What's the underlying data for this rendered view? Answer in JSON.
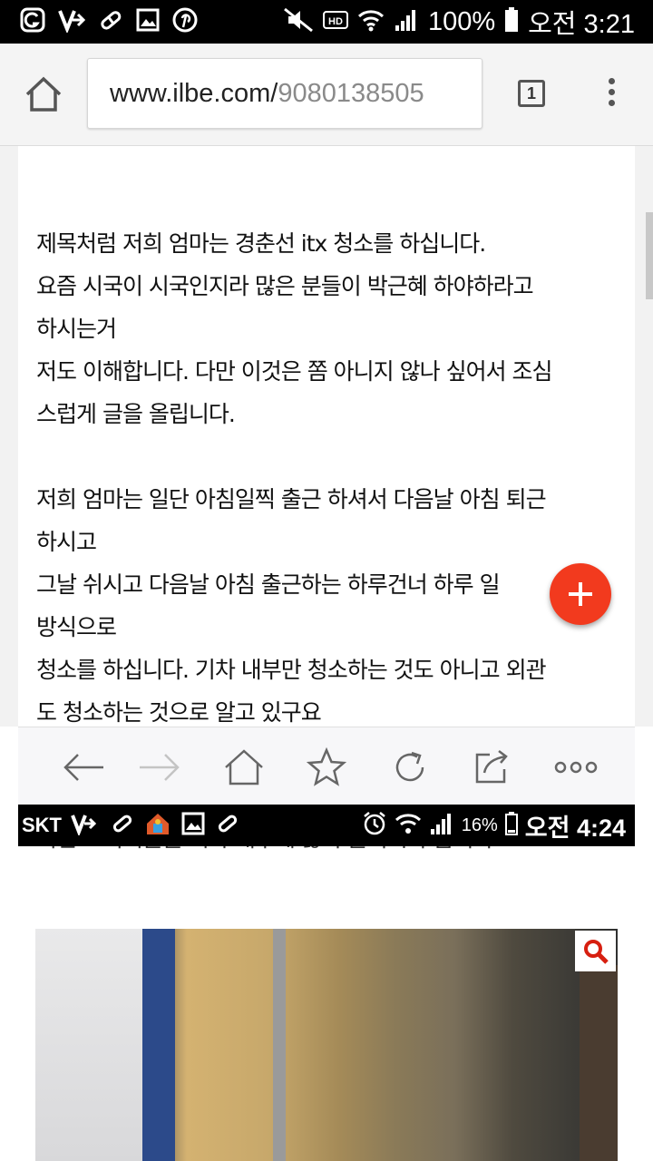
{
  "status_bar": {
    "battery": "100%",
    "time": "오전 3:21",
    "icons": [
      "g-icon",
      "v-icon",
      "pill-icon",
      "image-icon",
      "pinterest-icon",
      "mute-icon",
      "hd-icon",
      "wifi-icon",
      "signal-icon",
      "battery-icon"
    ]
  },
  "url_bar": {
    "host": "www.ilbe.com/",
    "path": "9080138505",
    "tab_count": "1"
  },
  "article": {
    "lines": [
      "제목처럼 저희 엄마는 경춘선 itx 청소를 하십니다.",
      "요즘 시국이 시국인지라 많은 분들이 박근혜 하야하라고",
      "하시는거",
      "저도 이해합니다.  다만 이것은 쫌 아니지 않나 싶어서 조심",
      "스럽게 글을 올립니다.",
      "",
      "저희 엄마는 일단 아침일찍 출근 하셔서 다음날 아침 퇴근",
      "하시고",
      "그날 쉬시고 다음날 아침 출근하는 하루건너 하루 일",
      "방식으로",
      "청소를 하십니다. 기차 내부만 청소하는 것도 아니고 외관",
      "도 청소하는 것으로 알고 있구요"
    ],
    "partial_line": "이번 스티커들을 기차 내부에 많이 붙이시다 봅니다."
  },
  "bottom_bar": {
    "icons": [
      "back-arrow-icon",
      "forward-arrow-icon",
      "home-icon",
      "star-icon",
      "refresh-icon",
      "share-icon",
      "more-icon"
    ]
  },
  "screenshot_status_bar": {
    "carrier": "SKT",
    "battery": "16%",
    "time": "오전 4:24"
  },
  "colors": {
    "fab": "#f23a1e",
    "status_bar": "#000000",
    "toolbar": "#f4f4f4"
  }
}
